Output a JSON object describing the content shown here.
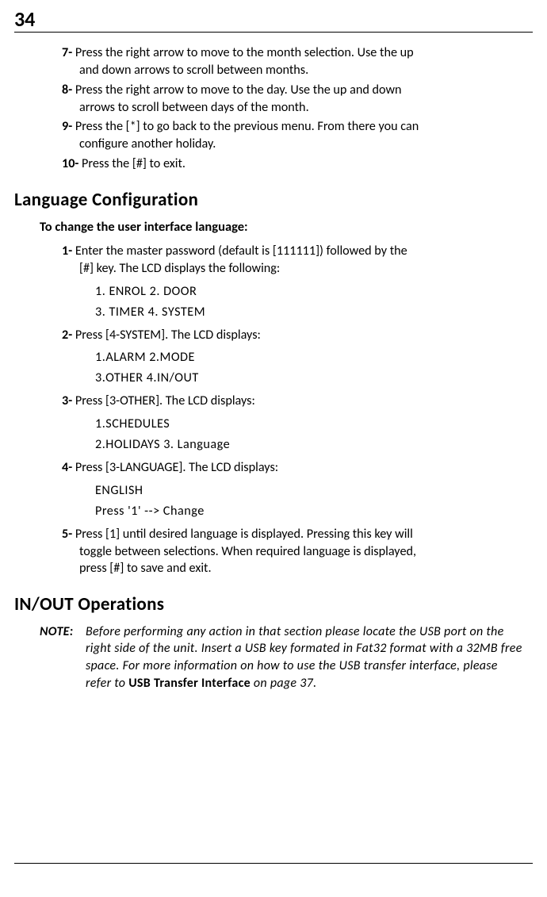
{
  "page_number": "34",
  "initial_steps": [
    {
      "num": "7-",
      "text": "Press the right arrow to move to the month selection. Use the up and down arrows to scroll between months."
    },
    {
      "num": "8-",
      "text": "Press the right arrow to move to the day. Use the up and down arrows to scroll between days of the month."
    },
    {
      "num": "9-",
      "text": "Press the [*] to go back to the previous menu. From there you can configure another holiday."
    },
    {
      "num": "10-",
      "text": "Press the [#] to exit."
    }
  ],
  "lang_heading": "Language Configuration",
  "lang_subheading": "To change the user interface language:",
  "lang_steps": {
    "s1": {
      "num": "1-",
      "text": "Enter the master password (default is [111111]) followed by the [#] key. The LCD displays the following:",
      "lcd": [
        "1. ENROL    2. DOOR",
        "3. TIMER    4. SYSTEM"
      ]
    },
    "s2": {
      "num": "2-",
      "text": "Press [4-SYSTEM]. The LCD displays:",
      "lcd": [
        "1.ALARM    2.MODE",
        "3.OTHER    4.IN/OUT"
      ]
    },
    "s3": {
      "num": "3-",
      "text": "Press [3-OTHER]. The LCD displays:",
      "lcd": [
        "1.SCHEDULES",
        "2.HOLIDAYS     3. Language"
      ]
    },
    "s4": {
      "num": "4-",
      "text": "Press [3-LANGUAGE]. The LCD displays:",
      "lcd": [
        "ENGLISH",
        "Press '1' --> Change"
      ]
    },
    "s5": {
      "num": "5-",
      "text": "Press [1] until desired language is displayed. Pressing this key will toggle between selections. When required language is displayed, press [#] to save and exit."
    }
  },
  "inout_heading": "IN/OUT Operations",
  "note": {
    "label": "NOTE:",
    "body_pre": "Before performing any action in that section please locate the USB port on the right side of the unit. Insert a USB key formated in Fat32 format with a 32MB free space. For more information on how to use the USB transfer interface, please refer to ",
    "body_strong": "USB Transfer Interface",
    "body_post": " on page 37."
  }
}
